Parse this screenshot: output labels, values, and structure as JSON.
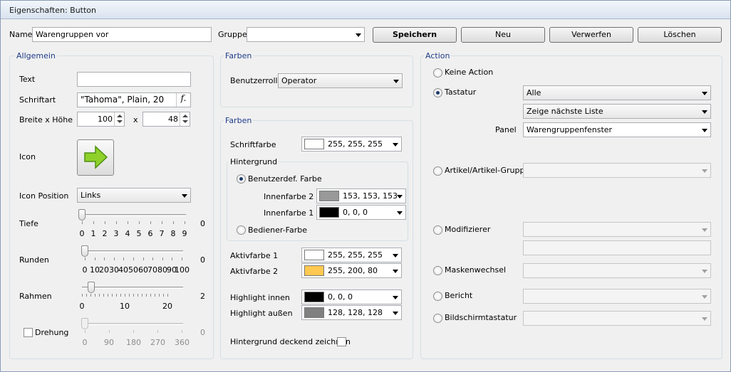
{
  "window": {
    "title": "Eigenschaften: Button"
  },
  "top": {
    "name_label": "Name",
    "name_value": "Warengruppen vor",
    "group_label": "Gruppe",
    "group_value": "",
    "save": "Speichern",
    "new": "Neu",
    "discard": "Verwerfen",
    "delete": "Löschen"
  },
  "general": {
    "title": "Allgemein",
    "text_label": "Text",
    "text_value": "",
    "font_label": "Schriftart",
    "font_value": "\"Tahoma\", Plain, 20",
    "font_btn": "f.",
    "size_label": "Breite x Höhe",
    "width": "100",
    "x": "x",
    "height": "48",
    "icon_label": "Icon",
    "iconpos_label": "Icon Position",
    "iconpos_value": "Links",
    "depth_label": "Tiefe",
    "depth_value": "0",
    "depth_ticks": [
      "0",
      "1",
      "2",
      "3",
      "4",
      "5",
      "6",
      "7",
      "8",
      "9"
    ],
    "round_label": "Runden",
    "round_value": "0",
    "round_ticks": [
      "0",
      "10",
      "20",
      "30",
      "40",
      "50",
      "60",
      "70",
      "80",
      "90",
      "100"
    ],
    "frame_label": "Rahmen",
    "frame_value": "2",
    "frame_ticks": [
      "0",
      "10",
      "20"
    ],
    "rot_label": "Drehung",
    "rot_value": "0",
    "rot_ticks": [
      "0",
      "90",
      "180",
      "270",
      "360"
    ]
  },
  "colors1": {
    "title": "Farben",
    "role_label": "Benutzerrolle",
    "role_value": "Operator"
  },
  "colors2": {
    "title": "Farben",
    "font_color_label": "Schriftfarbe",
    "font_color": "255, 255, 255",
    "bg_title": "Hintergrund",
    "custom_label": "Benutzerdef. Farbe",
    "inner2_label": "Innenfarbe 2",
    "inner2": "153, 153, 153",
    "inner1_label": "Innenfarbe 1",
    "inner1": "0, 0, 0",
    "operator_label": "Bediener-Farbe",
    "active1_label": "Aktivfarbe 1",
    "active1": "255, 255, 255",
    "active2_label": "Aktivfarbe 2",
    "active2": "255, 200, 80",
    "hl_in_label": "Highlight innen",
    "hl_in": "0, 0, 0",
    "hl_out_label": "Highlight außen",
    "hl_out": "128, 128, 128",
    "opaque_label": "Hintergrund deckend zeichnen"
  },
  "action": {
    "title": "Action",
    "none": "Keine Action",
    "keyboard": "Tastatur",
    "keyboard_value": "Alle",
    "next_list": "Zeige nächste Liste",
    "panel_label": "Panel",
    "panel_value": "Warengruppenfenster",
    "article": "Artikel/Artikel-Gruppe",
    "modifier": "Modifizierer",
    "mask": "Maskenwechsel",
    "report": "Bericht",
    "screen_kb": "Bildschirmtastatur"
  },
  "colors": {
    "white": "#ffffff",
    "gray153": "#999999",
    "black": "#000000",
    "yellow": "#ffc850",
    "gray128": "#808080",
    "accent": "#1f3c8a"
  }
}
